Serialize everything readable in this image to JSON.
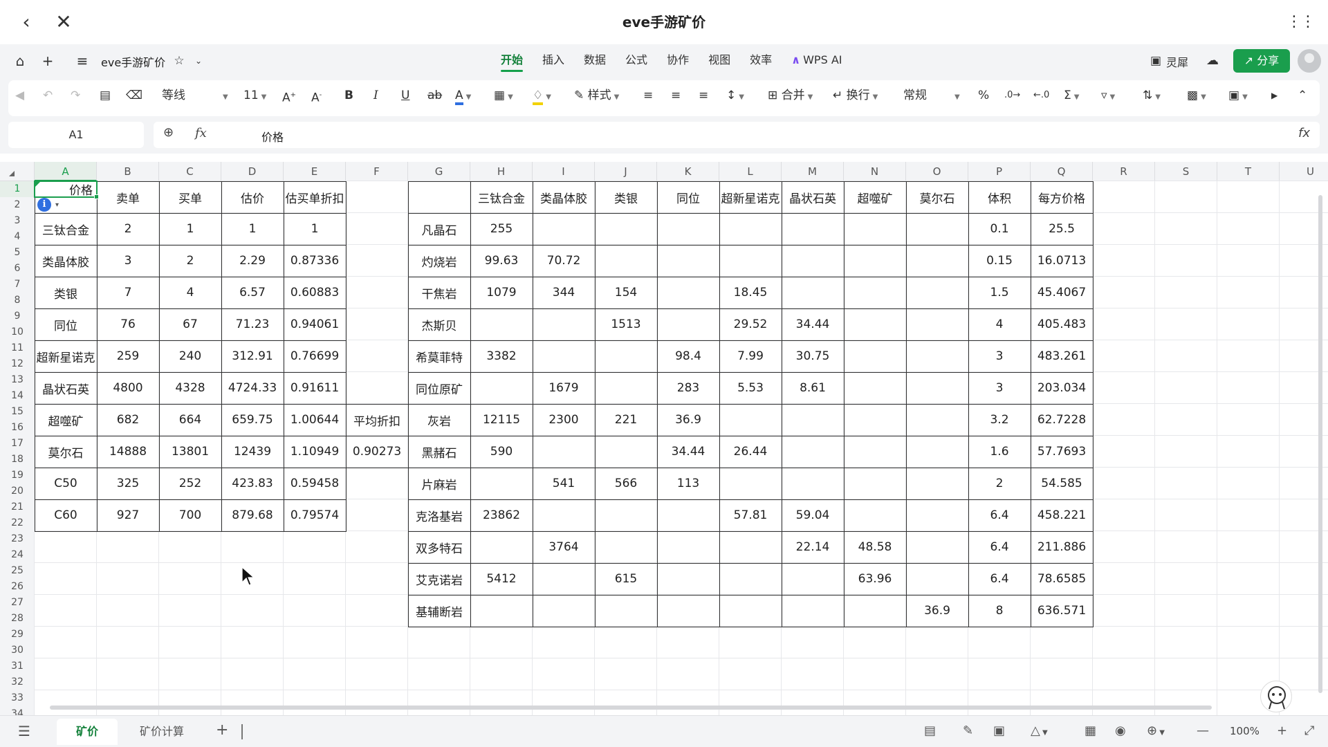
{
  "titlebar": {
    "title": "eve手游矿价"
  },
  "menubar": {
    "docname": "eve手游矿价",
    "tabs": [
      "开始",
      "插入",
      "数据",
      "公式",
      "协作",
      "视图",
      "效率",
      "WPS AI"
    ],
    "active_tab": 0,
    "lingxi": "灵犀",
    "share": "分享"
  },
  "toolbar": {
    "font": "等线",
    "size": "11",
    "style": "样式",
    "merge": "合并",
    "wrap": "换行",
    "format": "常规"
  },
  "formulabar": {
    "cell_ref": "A1",
    "value": "价格"
  },
  "columns": [
    "A",
    "B",
    "C",
    "D",
    "E",
    "F",
    "G",
    "H",
    "I",
    "J",
    "K",
    "L",
    "M",
    "N",
    "O",
    "P",
    "Q",
    "R",
    "S",
    "T",
    "U"
  ],
  "rows": [
    "1",
    "2",
    "3",
    "4",
    "5",
    "6",
    "7",
    "8",
    "9",
    "10",
    "11",
    "12",
    "13",
    "14",
    "15",
    "16",
    "17",
    "18",
    "19",
    "20",
    "21",
    "22",
    "23",
    "24",
    "25",
    "26",
    "27",
    "28",
    "29",
    "30",
    "31",
    "32",
    "33",
    "34"
  ],
  "left_table": {
    "header": [
      "价格",
      "卖单",
      "买单",
      "估价",
      "估买单折扣"
    ],
    "rows": [
      [
        "三钛合金",
        "2",
        "1",
        "1",
        "1"
      ],
      [
        "类晶体胶",
        "3",
        "2",
        "2.29",
        "0.87336"
      ],
      [
        "类银",
        "7",
        "4",
        "6.57",
        "0.60883"
      ],
      [
        "同位",
        "76",
        "67",
        "71.23",
        "0.94061"
      ],
      [
        "超新星诺克",
        "259",
        "240",
        "312.91",
        "0.76699"
      ],
      [
        "晶状石英",
        "4800",
        "4328",
        "4724.33",
        "0.91611"
      ],
      [
        "超噬矿",
        "682",
        "664",
        "659.75",
        "1.00644"
      ],
      [
        "莫尔石",
        "14888",
        "13801",
        "12439",
        "1.10949"
      ],
      [
        "C50",
        "325",
        "252",
        "423.83",
        "0.59458"
      ],
      [
        "C60",
        "927",
        "700",
        "879.68",
        "0.79574"
      ]
    ]
  },
  "avg_discount": {
    "label": "平均折扣",
    "value": "0.90273"
  },
  "right_table": {
    "header": [
      "",
      "三钛合金",
      "类晶体胶",
      "类银",
      "同位",
      "超新星诺克",
      "晶状石英",
      "超噬矿",
      "莫尔石",
      "体积",
      "每方价格"
    ],
    "rows": [
      [
        "凡晶石",
        "255",
        "",
        "",
        "",
        "",
        "",
        "",
        "",
        "0.1",
        "25.5"
      ],
      [
        "灼烧岩",
        "99.63",
        "70.72",
        "",
        "",
        "",
        "",
        "",
        "",
        "0.15",
        "16.0713"
      ],
      [
        "干焦岩",
        "1079",
        "344",
        "154",
        "",
        "18.45",
        "",
        "",
        "",
        "1.5",
        "45.4067"
      ],
      [
        "杰斯贝",
        "",
        "",
        "1513",
        "",
        "29.52",
        "34.44",
        "",
        "",
        "4",
        "405.483"
      ],
      [
        "希莫菲特",
        "3382",
        "",
        "",
        "98.4",
        "7.99",
        "30.75",
        "",
        "",
        "3",
        "483.261"
      ],
      [
        "同位原矿",
        "",
        "1679",
        "",
        "283",
        "5.53",
        "8.61",
        "",
        "",
        "3",
        "203.034"
      ],
      [
        "灰岩",
        "12115",
        "2300",
        "221",
        "36.9",
        "",
        "",
        "",
        "",
        "3.2",
        "62.7228"
      ],
      [
        "黑赭石",
        "590",
        "",
        "",
        "34.44",
        "26.44",
        "",
        "",
        "",
        "1.6",
        "57.7693"
      ],
      [
        "片麻岩",
        "",
        "541",
        "566",
        "113",
        "",
        "",
        "",
        "",
        "2",
        "54.585"
      ],
      [
        "克洛基岩",
        "23862",
        "",
        "",
        "",
        "57.81",
        "59.04",
        "",
        "",
        "6.4",
        "458.221"
      ],
      [
        "双多特石",
        "",
        "3764",
        "",
        "",
        "",
        "22.14",
        "48.58",
        "",
        "6.4",
        "211.886"
      ],
      [
        "艾克诺岩",
        "5412",
        "",
        "615",
        "",
        "",
        "",
        "63.96",
        "",
        "6.4",
        "78.6585"
      ],
      [
        "基辅断岩",
        "",
        "",
        "",
        "",
        "",
        "",
        "",
        "36.9",
        "8",
        "636.571"
      ]
    ]
  },
  "sheets": [
    "矿价",
    "矿价计算"
  ],
  "active_sheet": 0,
  "zoom": "100%"
}
